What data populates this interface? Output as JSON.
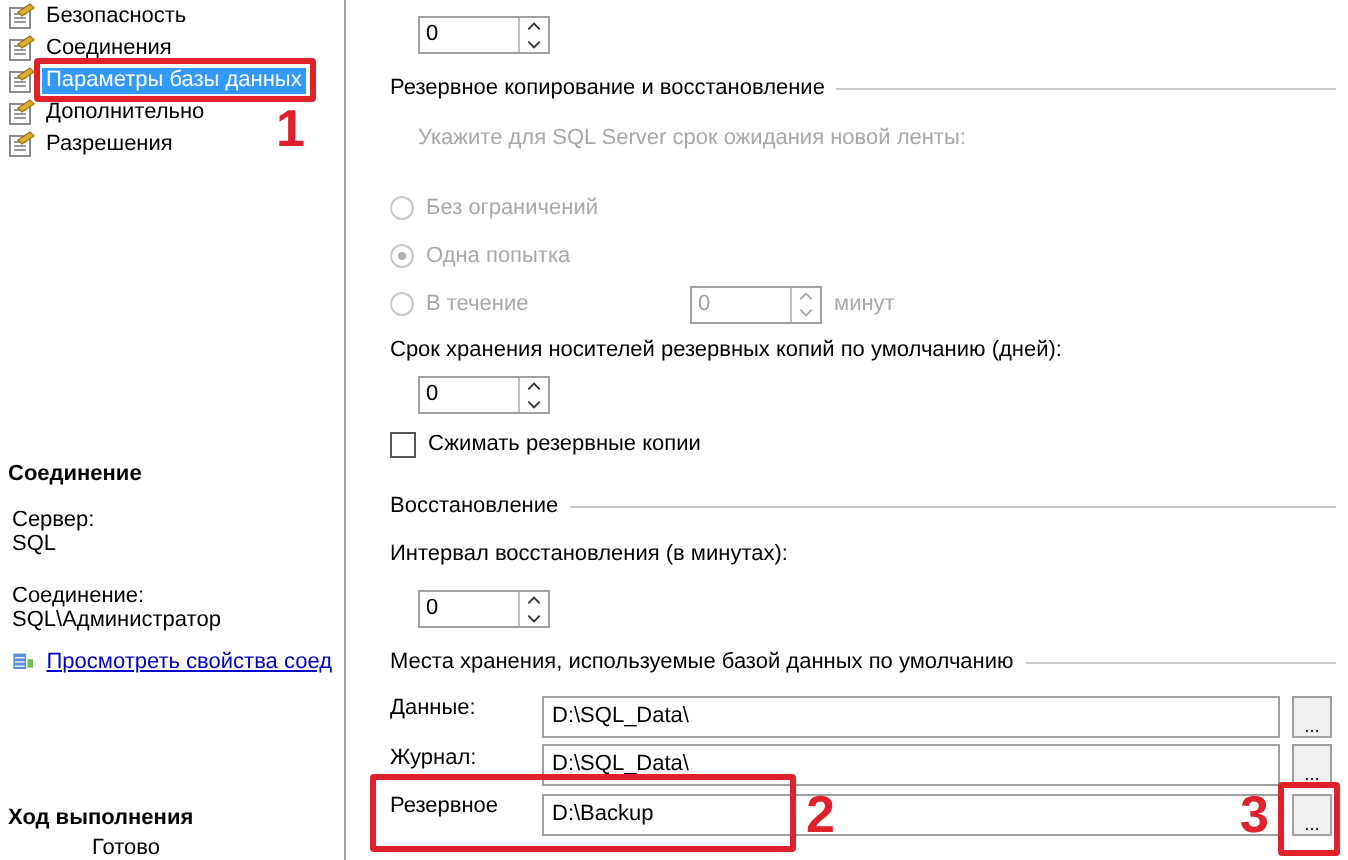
{
  "sidebar": {
    "pages": [
      {
        "label": "Безопасность",
        "selected": false
      },
      {
        "label": "Соединения",
        "selected": false
      },
      {
        "label": "Параметры базы данных",
        "selected": true
      },
      {
        "label": "Дополнительно",
        "selected": false
      },
      {
        "label": "Разрешения",
        "selected": false
      }
    ],
    "connection": {
      "title": "Соединение",
      "server_label": "Сервер:",
      "server": "SQL",
      "connection_label": "Соединение:",
      "connection": "SQL\\Администратор",
      "link": "Просмотреть свойства соед"
    },
    "progress": {
      "title": "Ход выполнения",
      "status": "Готово"
    }
  },
  "top_spin": {
    "value": "0"
  },
  "backup": {
    "title": "Резервное копирование и восстановление",
    "hint": "Укажите для SQL Server срок ожидания новой ленты:",
    "disabled": true,
    "options": [
      {
        "label": "Без ограничений",
        "selected": false
      },
      {
        "label": "Одна попытка",
        "selected": true
      },
      {
        "label": "В течение",
        "selected": false
      }
    ],
    "minutes_value": "0",
    "minutes_unit": "минут",
    "retention_label": "Срок хранения носителей резервных копий по умолчанию (дней):",
    "retention_value": "0",
    "compress": {
      "label": "Сжимать резервные копии",
      "checked": false
    }
  },
  "recovery": {
    "title": "Восстановление",
    "interval_label": "Интервал восстановления (в минутах):",
    "interval_value": "0"
  },
  "locations": {
    "title": "Места хранения, используемые базой данных по умолчанию",
    "rows": [
      {
        "label": "Данные:",
        "value": "D:\\SQL_Data\\",
        "button": "..."
      },
      {
        "label": "Журнал:",
        "value": "D:\\SQL_Data\\",
        "button": "..."
      },
      {
        "label": "Резервное",
        "value": "D:\\Backup",
        "button": "..."
      }
    ]
  },
  "annotations": [
    {
      "label": "1"
    },
    {
      "label": "2"
    },
    {
      "label": "3"
    }
  ]
}
